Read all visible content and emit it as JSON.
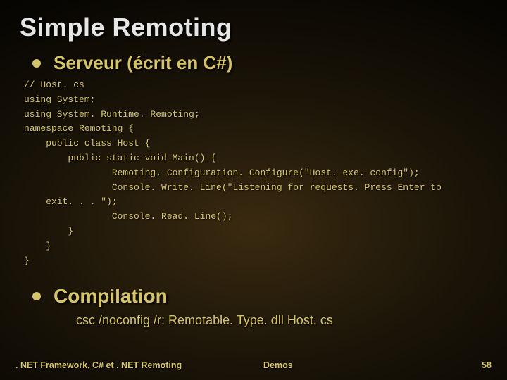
{
  "title": "Simple Remoting",
  "bullet1": "Serveur (écrit en C#)",
  "code": "// Host. cs\nusing System;\nusing System. Runtime. Remoting;\nnamespace Remoting {\n    public class Host {\n        public static void Main() {\n                Remoting. Configuration. Configure(\"Host. exe. config\");\n                Console. Write. Line(\"Listening for requests. Press Enter to\n    exit. . . \");\n                Console. Read. Line();\n        }\n    }\n}",
  "bullet2": "Compilation",
  "cmd": "csc /noconfig /r: Remotable. Type. dll Host. cs",
  "footer": {
    "left": ". NET Framework, C# et . NET Remoting",
    "center": "Demos",
    "right": "58"
  }
}
